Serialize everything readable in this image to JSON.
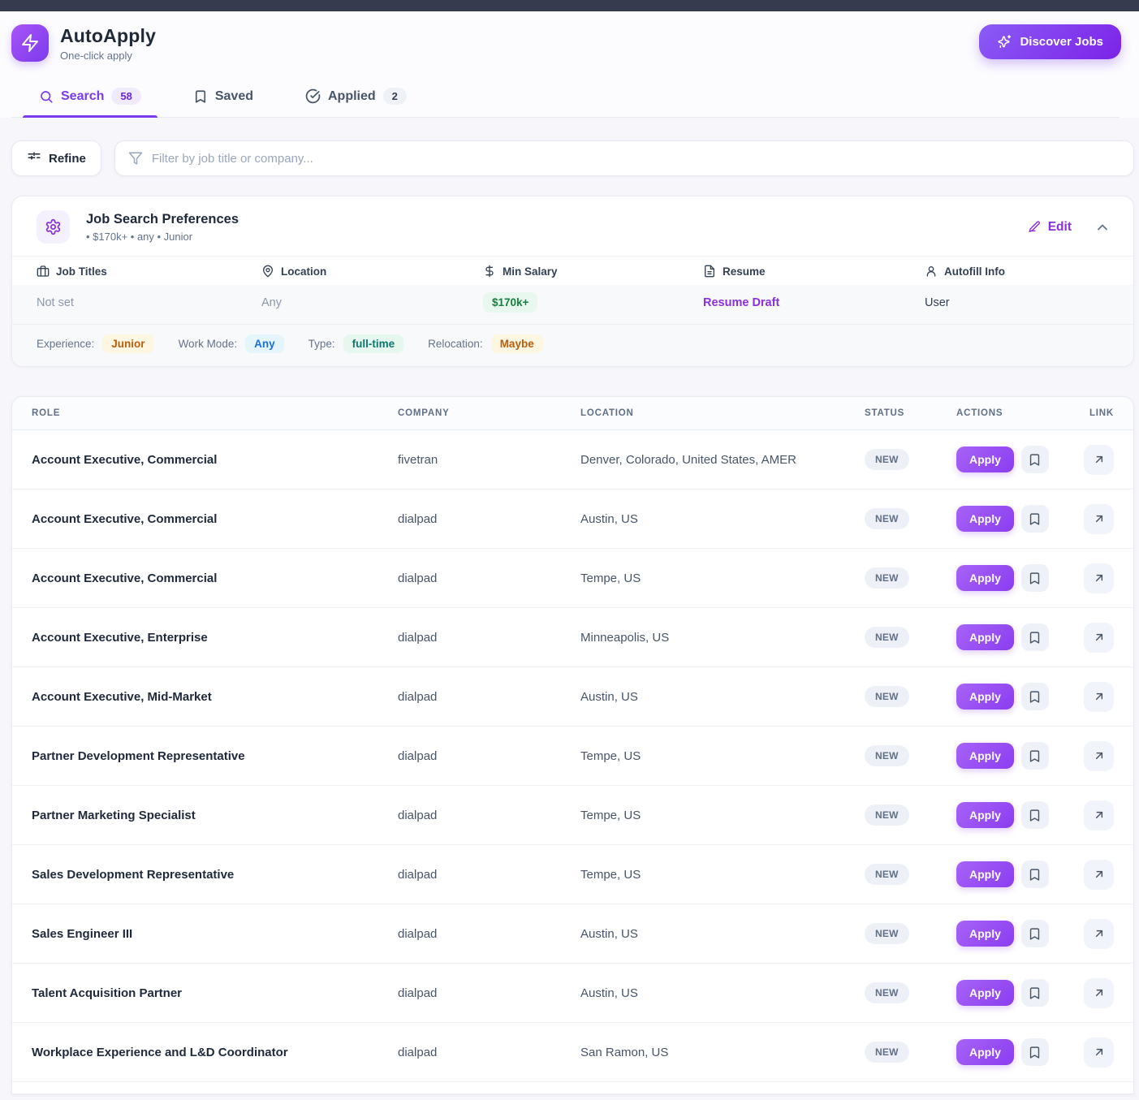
{
  "header": {
    "app_name": "AutoApply",
    "tagline": "One-click apply",
    "discover_button": "Discover Jobs"
  },
  "tabs": [
    {
      "label": "Search",
      "count": "58",
      "icon": "search-icon",
      "active": true
    },
    {
      "label": "Saved",
      "count": "",
      "icon": "bookmark-icon",
      "active": false
    },
    {
      "label": "Applied",
      "count": "2",
      "icon": "circle-check-icon",
      "active": false
    }
  ],
  "filters": {
    "refine_label": "Refine",
    "search_placeholder": "Filter by job title or company..."
  },
  "preferences": {
    "title": "Job Search Preferences",
    "subtitle": "• $170k+ • any • Junior",
    "edit_label": "Edit",
    "fields": [
      {
        "icon": "briefcase-icon",
        "label": "Job Titles",
        "value": "Not set"
      },
      {
        "icon": "map-pin-icon",
        "label": "Location",
        "value": "Any"
      },
      {
        "icon": "dollar-icon",
        "label": "Min Salary",
        "value": "$170k+"
      },
      {
        "icon": "file-text-icon",
        "label": "Resume",
        "value": "Resume Draft"
      },
      {
        "icon": "user-icon",
        "label": "Autofill Info",
        "value": "User"
      }
    ],
    "traits": [
      {
        "label": "Experience:",
        "value": "Junior",
        "color": "amber"
      },
      {
        "label": "Work Mode:",
        "value": "Any",
        "color": "blue"
      },
      {
        "label": "Type:",
        "value": "full-time",
        "color": "teal"
      },
      {
        "label": "Relocation:",
        "value": "Maybe",
        "color": "amber"
      }
    ]
  },
  "jobs_table": {
    "headers": [
      "ROLE",
      "COMPANY",
      "LOCATION",
      "STATUS",
      "ACTIONS",
      "LINK"
    ],
    "apply_label": "Apply",
    "rows": [
      {
        "role": "Account Executive, Commercial",
        "company": "fivetran",
        "location": "Denver, Colorado, United States, AMER",
        "status": "NEW"
      },
      {
        "role": "Account Executive, Commercial",
        "company": "dialpad",
        "location": "Austin, US",
        "status": "NEW"
      },
      {
        "role": "Account Executive, Commercial",
        "company": "dialpad",
        "location": "Tempe, US",
        "status": "NEW"
      },
      {
        "role": "Account Executive, Enterprise",
        "company": "dialpad",
        "location": "Minneapolis, US",
        "status": "NEW"
      },
      {
        "role": "Account Executive, Mid-Market",
        "company": "dialpad",
        "location": "Austin, US",
        "status": "NEW"
      },
      {
        "role": "Partner Development Representative",
        "company": "dialpad",
        "location": "Tempe, US",
        "status": "NEW"
      },
      {
        "role": "Partner Marketing Specialist",
        "company": "dialpad",
        "location": "Tempe, US",
        "status": "NEW"
      },
      {
        "role": "Sales Development Representative",
        "company": "dialpad",
        "location": "Tempe, US",
        "status": "NEW"
      },
      {
        "role": "Sales Engineer III",
        "company": "dialpad",
        "location": "Austin, US",
        "status": "NEW"
      },
      {
        "role": "Talent Acquisition Partner",
        "company": "dialpad",
        "location": "Austin, US",
        "status": "NEW"
      },
      {
        "role": "Workplace Experience and L&D Coordinator",
        "company": "dialpad",
        "location": "San Ramon, US",
        "status": "NEW"
      }
    ]
  },
  "colors": {
    "accent_purple": "#7c3aed",
    "topbar": "#363c4d",
    "salary_green": "#15803d",
    "badge_amber_text": "#bc5e0b",
    "badge_blue_text": "#1d6fd8",
    "badge_teal_text": "#0f766e"
  }
}
